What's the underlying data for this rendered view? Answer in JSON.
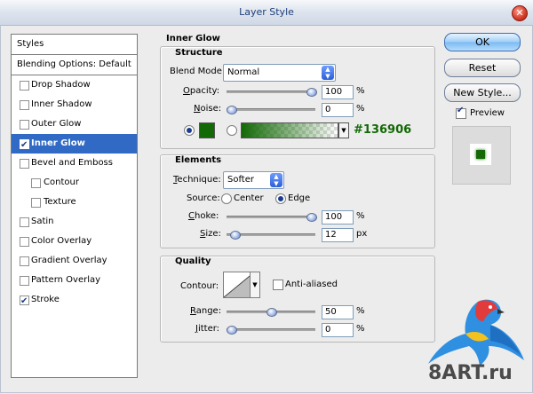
{
  "window": {
    "title": "Layer Style"
  },
  "styles_panel": {
    "header": "Styles",
    "blending": "Blending Options: Default",
    "items": [
      {
        "label": "Drop Shadow",
        "checked": false,
        "sub": false,
        "selected": false
      },
      {
        "label": "Inner Shadow",
        "checked": false,
        "sub": false,
        "selected": false
      },
      {
        "label": "Outer Glow",
        "checked": false,
        "sub": false,
        "selected": false
      },
      {
        "label": "Inner Glow",
        "checked": true,
        "sub": false,
        "selected": true
      },
      {
        "label": "Bevel and Emboss",
        "checked": false,
        "sub": false,
        "selected": false
      },
      {
        "label": "Contour",
        "checked": false,
        "sub": true,
        "selected": false
      },
      {
        "label": "Texture",
        "checked": false,
        "sub": true,
        "selected": false
      },
      {
        "label": "Satin",
        "checked": false,
        "sub": false,
        "selected": false
      },
      {
        "label": "Color Overlay",
        "checked": false,
        "sub": false,
        "selected": false
      },
      {
        "label": "Gradient Overlay",
        "checked": false,
        "sub": false,
        "selected": false
      },
      {
        "label": "Pattern Overlay",
        "checked": false,
        "sub": false,
        "selected": false
      },
      {
        "label": "Stroke",
        "checked": true,
        "sub": false,
        "selected": false
      }
    ]
  },
  "inner_glow": {
    "title": "Inner Glow",
    "structure": {
      "title": "Structure",
      "blend_mode_label": "Blend Mode:",
      "blend_mode": "Normal",
      "opacity_label": "Opacity:",
      "opacity": "100",
      "opacity_fraction": 1.0,
      "noise_label": "Noise:",
      "noise": "0",
      "noise_fraction": 0.0,
      "percent": "%",
      "glow_color": "#136906",
      "glow_hex_label": "#136906"
    },
    "elements": {
      "title": "Elements",
      "technique_label": "Technique:",
      "technique": "Softer",
      "source_label": "Source:",
      "source_center": "Center",
      "source_edge": "Edge",
      "choke_label": "Choke:",
      "choke": "100",
      "choke_fraction": 1.0,
      "size_label": "Size:",
      "size": "12",
      "size_fraction": 0.048,
      "percent": "%",
      "px": "px"
    },
    "quality": {
      "title": "Quality",
      "contour_label": "Contour:",
      "anti_aliased": "Anti-aliased",
      "range_label": "Range:",
      "range": "50",
      "range_fraction": 0.5,
      "jitter_label": "Jitter:",
      "jitter": "0",
      "jitter_fraction": 0.0,
      "percent": "%"
    }
  },
  "buttons": {
    "ok": "OK",
    "reset": "Reset",
    "new_style": "New Style...",
    "preview": "Preview"
  },
  "watermark": {
    "text": "8ART.ru"
  }
}
